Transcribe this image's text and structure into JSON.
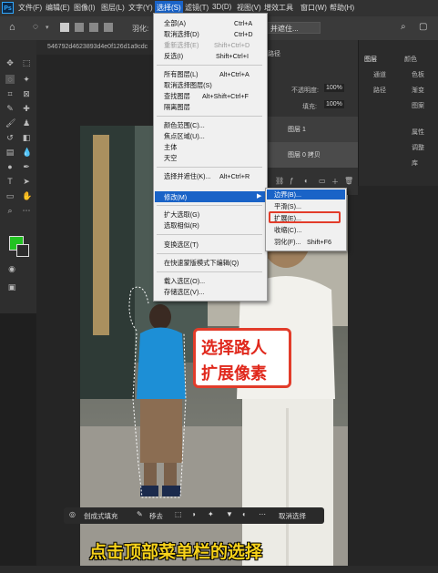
{
  "app": {
    "logo": "Ps"
  },
  "menubar": {
    "items": [
      "文件(F)",
      "编辑(E)",
      "图像(I)",
      "图层(L)",
      "文字(Y)",
      "选择(S)",
      "滤镜(T)",
      "3D(D)",
      "视图(V)",
      "增效工具",
      "窗口(W)",
      "帮助(H)"
    ],
    "active_index": 5
  },
  "options_bar": {
    "feather_label": "羽化:",
    "select_mask_label": "并遮住..."
  },
  "document_tab": {
    "title": "546792d4623893d4e0f126d1a9cdc"
  },
  "select_menu": {
    "items": [
      {
        "label": "全部(A)",
        "shortcut": "Ctrl+A",
        "disabled": false
      },
      {
        "label": "取消选择(D)",
        "shortcut": "Ctrl+D",
        "disabled": false
      },
      {
        "label": "重新选择(E)",
        "shortcut": "Shift+Ctrl+D",
        "disabled": true
      },
      {
        "label": "反选(I)",
        "shortcut": "Shift+Ctrl+I",
        "disabled": false
      },
      {
        "label": "所有图层(L)",
        "shortcut": "Alt+Ctrl+A",
        "disabled": false
      },
      {
        "label": "取消选择图层(S)",
        "shortcut": "",
        "disabled": false
      },
      {
        "label": "查找图层",
        "shortcut": "Alt+Shift+Ctrl+F",
        "disabled": false
      },
      {
        "label": "隔离图层",
        "shortcut": "",
        "disabled": false
      },
      {
        "label": "颜色范围(C)...",
        "shortcut": "",
        "disabled": false
      },
      {
        "label": "焦点区域(U)...",
        "shortcut": "",
        "disabled": false
      },
      {
        "label": "主体",
        "shortcut": "",
        "disabled": false
      },
      {
        "label": "天空",
        "shortcut": "",
        "disabled": false
      },
      {
        "label": "选择并遮住(K)...",
        "shortcut": "Alt+Ctrl+R",
        "disabled": false
      },
      {
        "label": "修改(M)",
        "shortcut": "",
        "disabled": false
      },
      {
        "label": "扩大选取(G)",
        "shortcut": "",
        "disabled": false
      },
      {
        "label": "选取相似(R)",
        "shortcut": "",
        "disabled": false
      },
      {
        "label": "变换选区(T)",
        "shortcut": "",
        "disabled": false
      },
      {
        "label": "在快速蒙版模式下编辑(Q)",
        "shortcut": "",
        "disabled": false
      },
      {
        "label": "载入选区(O)...",
        "shortcut": "",
        "disabled": false
      },
      {
        "label": "存储选区(V)...",
        "shortcut": "",
        "disabled": false
      }
    ]
  },
  "modify_submenu": {
    "items": [
      {
        "label": "边界(B)...",
        "shortcut": ""
      },
      {
        "label": "平滑(S)...",
        "shortcut": ""
      },
      {
        "label": "扩展(E)...",
        "shortcut": ""
      },
      {
        "label": "收缩(C)...",
        "shortcut": ""
      },
      {
        "label": "羽化(F)...",
        "shortcut": "Shift+F6"
      }
    ]
  },
  "layers_panel": {
    "tab_label": "路径",
    "opacity_label": "不透明度:",
    "opacity_value": "100%",
    "fill_label": "填充:",
    "fill_value": "100%",
    "layers": [
      "图层 1",
      "图层 0 拷贝"
    ]
  },
  "side_panels": {
    "items": [
      "图层",
      "颜色",
      "通道",
      "色板",
      "路径",
      "渐变",
      "图案",
      "属性",
      "调整",
      "库"
    ]
  },
  "context_taskbar": {
    "fill_label": "创成式填充",
    "remove_label": "移去",
    "deselect_label": "取消选择"
  },
  "overlay": {
    "callout_line1": "选择路人",
    "callout_line2": "扩展像素",
    "caption": "点击顶部菜单栏的选择"
  },
  "colors": {
    "accent": "#1a63c7",
    "foreground_swatch": "#22c222",
    "callout_red": "#e0281c",
    "caption_yellow": "#f7d21a"
  }
}
